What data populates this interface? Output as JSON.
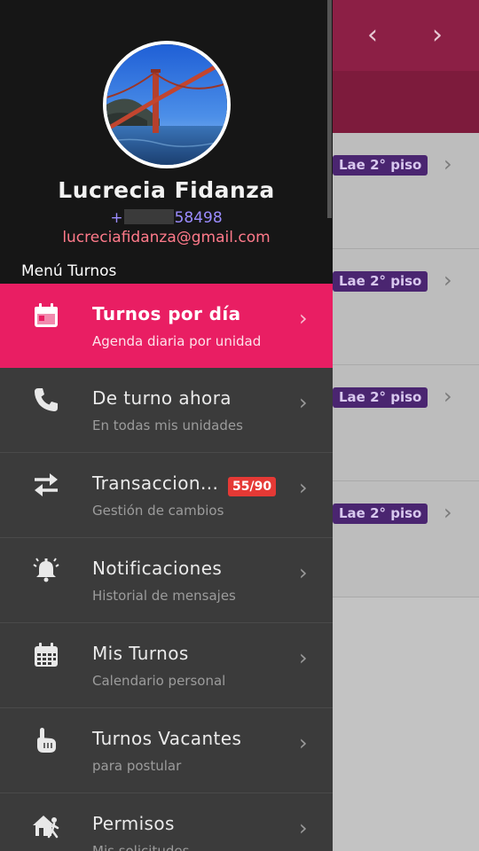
{
  "background": {
    "nav": {
      "prev_icon": "‹",
      "next_icon": "›"
    },
    "rows": [
      {
        "badge": "Lae 2° piso"
      },
      {
        "badge": "Lae 2° piso"
      },
      {
        "badge": "Lae 2° piso"
      },
      {
        "badge": "Lae 2° piso"
      }
    ],
    "chevron": "›"
  },
  "drawer": {
    "user": {
      "name": "Lucrecia Fidanza",
      "phone_prefix": "+",
      "phone_suffix": "58498",
      "email": "lucreciafidanza@gmail.com"
    },
    "menu_title": "Menú Turnos",
    "items": [
      {
        "icon": "calendar-icon",
        "label": "Turnos por día",
        "sub": "Agenda diaria por unidad",
        "active": true
      },
      {
        "icon": "phone-icon",
        "label": "De turno ahora",
        "sub": "En todas mis unidades"
      },
      {
        "icon": "swap-arrows-icon",
        "label": "Transaccion...",
        "sub": "Gestión de cambios",
        "badge": "55/90"
      },
      {
        "icon": "bell-ringing-icon",
        "label": "Notificaciones",
        "sub": "Historial de mensajes"
      },
      {
        "icon": "calendar-grid-icon",
        "label": "Mis Turnos",
        "sub": "Calendario personal"
      },
      {
        "icon": "hand-pointing-icon",
        "label": "Turnos Vacantes",
        "sub": "para postular"
      },
      {
        "icon": "house-walking-icon",
        "label": "Permisos",
        "sub": "Mis solicitudes"
      }
    ],
    "chevron": "›"
  },
  "colors": {
    "accent": "#e91e63",
    "badge_red": "#e53935",
    "drawer_bg": "#3b3b3b",
    "header_bg": "#161616",
    "topbar": "#8c1f45"
  }
}
